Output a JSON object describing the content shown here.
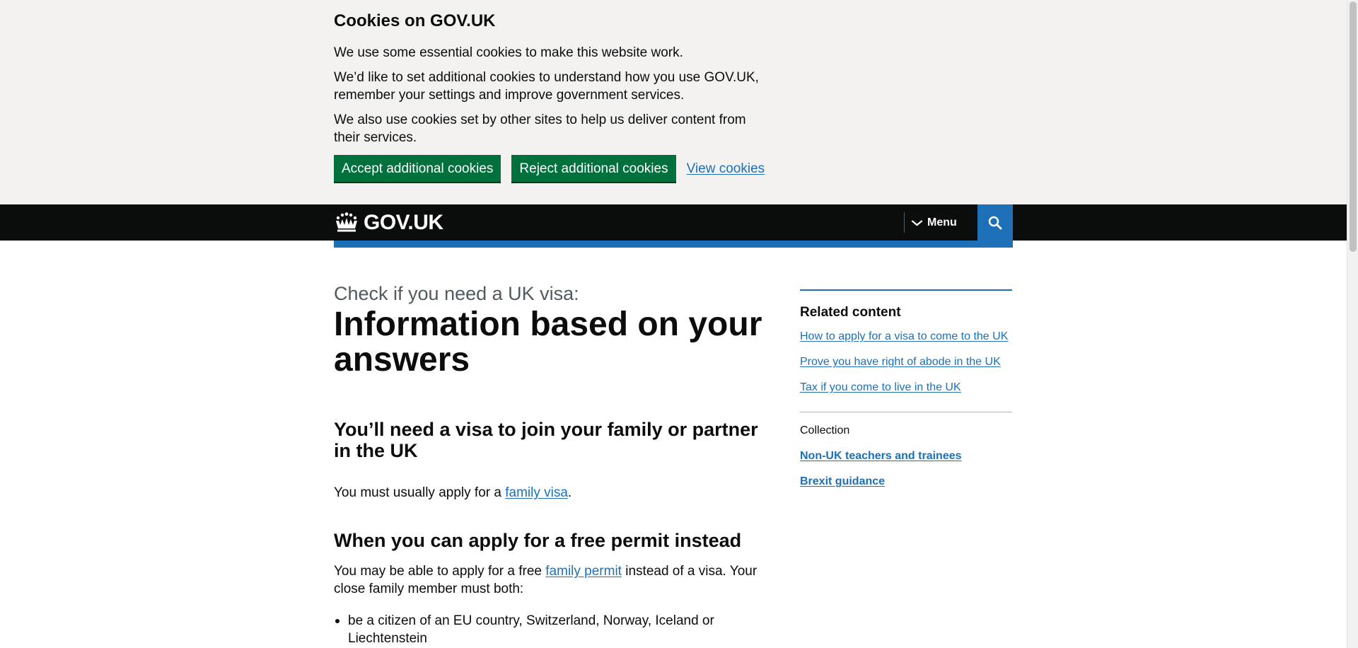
{
  "cookie_banner": {
    "title": "Cookies on GOV.UK",
    "p1": "We use some essential cookies to make this website work.",
    "p2": "We’d like to set additional cookies to understand how you use GOV.UK, remember your settings and improve government services.",
    "p3": "We also use cookies set by other sites to help us deliver content from their services.",
    "accept_label": "Accept additional cookies",
    "reject_label": "Reject additional cookies",
    "view_label": "View cookies"
  },
  "header": {
    "logo_text": "GOV.UK",
    "menu_label": "Menu",
    "logo_icon": "crown-icon",
    "search_icon": "search-icon",
    "background": "#0b0c0c",
    "accent": "#1d70b8"
  },
  "main": {
    "caption": "Check if you need a UK visa:",
    "title": "Information based on your answers",
    "section1_heading": "You’ll need a visa to join your family or partner in the UK",
    "section1_text_before": "You must usually apply for a ",
    "section1_link": "family visa",
    "section1_text_after": ".",
    "section2_heading": "When you can apply for a free permit instead",
    "section2_text_before": "You may be able to apply for a free ",
    "section2_link": "family permit",
    "section2_text_after": " instead of a visa. Your close family member must both:",
    "list_items": [
      "be a citizen of an EU country, Switzerland, Norway, Iceland or Liechtenstein"
    ]
  },
  "sidebar": {
    "heading": "Related content",
    "links": [
      "How to apply for a visa to come to the UK",
      "Prove you have right of abode in the UK",
      "Tax if you come to live in the UK"
    ],
    "collection_label": "Collection",
    "collection_links": [
      "Non-UK teachers and trainees",
      "Brexit guidance"
    ]
  },
  "colors": {
    "button_green": "#00703c",
    "link_blue": "#1d70b8",
    "banner_grey": "#f3f2f1"
  }
}
